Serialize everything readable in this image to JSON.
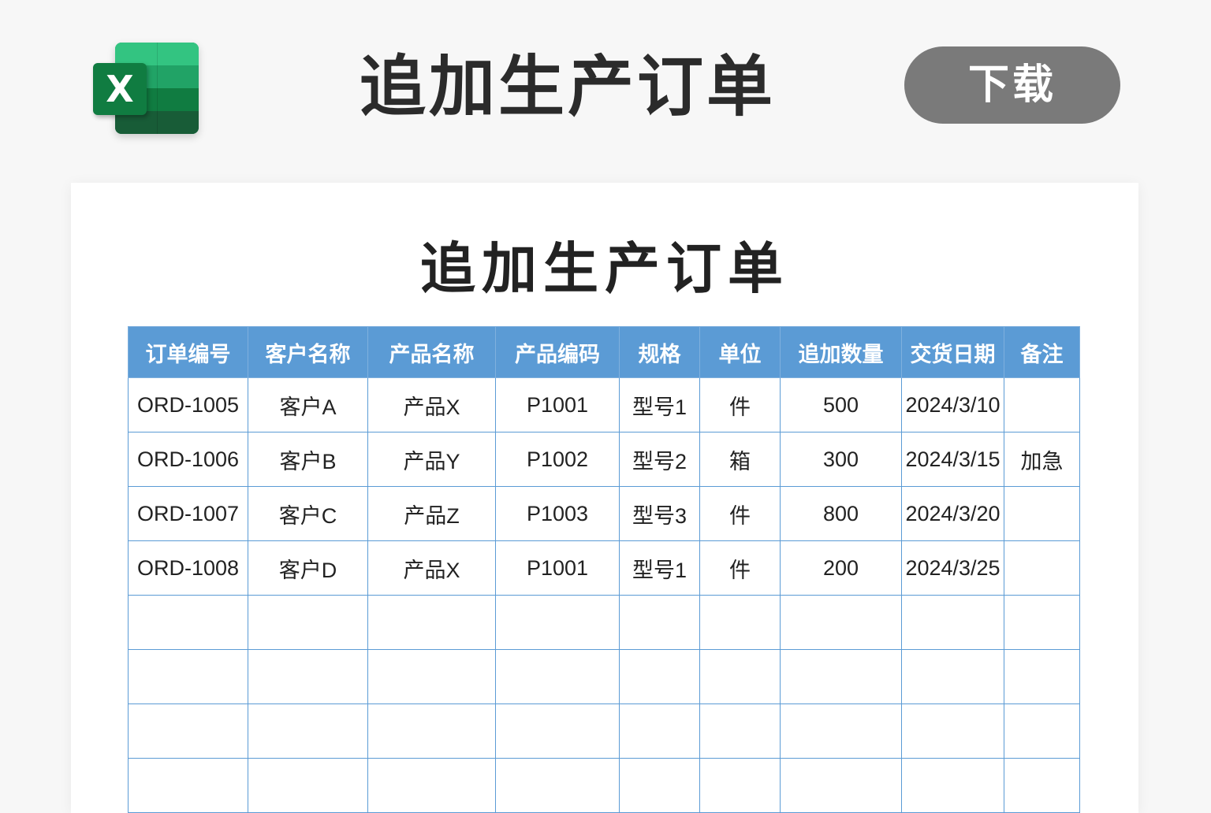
{
  "header": {
    "logo_letter": "X",
    "app_title": "追加生产订单",
    "download_label": "下载"
  },
  "document": {
    "title": "追加生产订单",
    "columns": [
      "订单编号",
      "客户名称",
      "产品名称",
      "产品编码",
      "规格",
      "单位",
      "追加数量",
      "交货日期",
      "备注"
    ],
    "rows": [
      [
        "ORD-1005",
        "客户A",
        "产品X",
        "P1001",
        "型号1",
        "件",
        "500",
        "2024/3/10",
        ""
      ],
      [
        "ORD-1006",
        "客户B",
        "产品Y",
        "P1002",
        "型号2",
        "箱",
        "300",
        "2024/3/15",
        "加急"
      ],
      [
        "ORD-1007",
        "客户C",
        "产品Z",
        "P1003",
        "型号3",
        "件",
        "800",
        "2024/3/20",
        ""
      ],
      [
        "ORD-1008",
        "客户D",
        "产品X",
        "P1001",
        "型号1",
        "件",
        "200",
        "2024/3/25",
        ""
      ],
      [
        "",
        "",
        "",
        "",
        "",
        "",
        "",
        "",
        ""
      ],
      [
        "",
        "",
        "",
        "",
        "",
        "",
        "",
        "",
        ""
      ],
      [
        "",
        "",
        "",
        "",
        "",
        "",
        "",
        "",
        ""
      ],
      [
        "",
        "",
        "",
        "",
        "",
        "",
        "",
        "",
        ""
      ]
    ]
  },
  "colors": {
    "header_fill": "#5b9bd5",
    "grid_line": "#5b9bd5",
    "button_fill": "#7a7a7a",
    "excel_green": "#107c41"
  },
  "icons": {
    "logo": "excel-icon"
  }
}
